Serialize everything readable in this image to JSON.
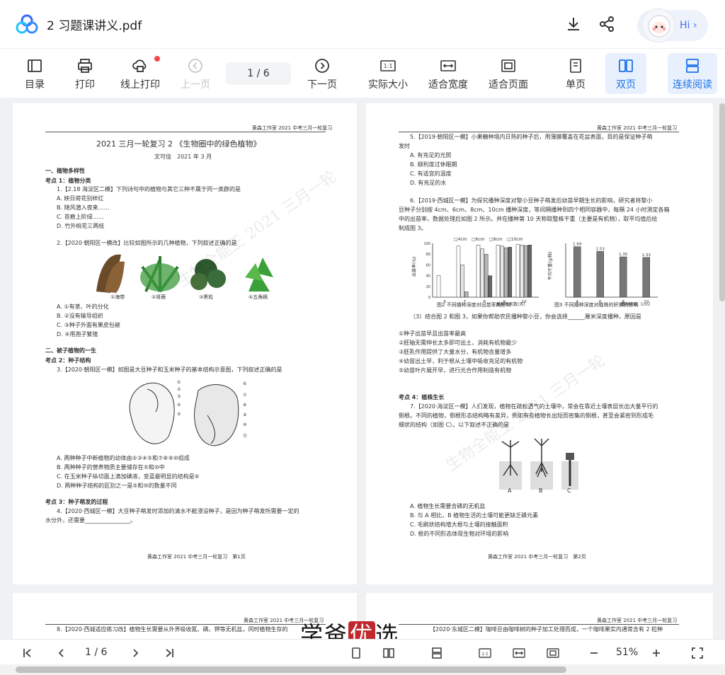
{
  "app": {
    "title": "2 习题课讲义.pdf",
    "assistant_label": "Hi"
  },
  "toolbar": {
    "items": [
      "目录",
      "打印",
      "线上打印",
      "上一页",
      "1 / 6",
      "下一页",
      "实际大小",
      "适合宽度",
      "适合页面",
      "单页",
      "双页",
      "连续阅读"
    ]
  },
  "bottom": {
    "page": "1 / 6",
    "zoom": "51%"
  },
  "colors": {
    "accent": "#1a73e8"
  },
  "page1": {
    "header": "黄森工作室 2021 中考三月一轮复习",
    "title": "2021 三月一轮复习 2 《生物圈中的绿色植物》",
    "author": "文可佳　2021 年 3 月",
    "lines": [
      "一、植物多样性",
      "考点 1：植物分类",
      "1.【2.18 海淀区二模】下列诗句中的植物与其它三种不属于同一类群的是",
      "A. 映日荷花别样红",
      "B. 随风潜入夜来……",
      "C. 苔痕上阶绿……",
      "D. 竹外桃花三两枝",
      "2.【2020·朝阳区一模改】比较如图所示的几种植物，下列叙述正确的是",
      "A. ①有茎、叶的分化",
      "B. ②没有输导组织",
      "C. ③种子外面有果皮包被",
      "D. ④用孢子繁殖",
      "二、被子植物的一生",
      "考点 2：种子结构",
      "3.【2020·朝阳区一模】如图是大豆种子和玉米种子的基本结构示意图，下列叙述正确的是",
      "A. 两种种子中新植物的幼体由②③④⑤和⑦⑧⑨⑩组成",
      "B. 两种种子的营养物质主要储存在⑤和⑩中",
      "C. 在玉米种子纵切面上滴加碘液，变蓝最明显的结构是⑥",
      "D. 两种种子结构的区别之一是⑤和⑩的数量不同",
      "考点 3：种子萌发的过程",
      "4.【2020·西城区一模】大豆种子萌发时添加的清水不能浸没种子，是因为种子萌发所需要一定的",
      "水分外，还需要________________。"
    ],
    "plant_labels": [
      "①海带",
      "②肾蕨",
      "③黑松",
      "④五角枫"
    ],
    "footer": "黄森工作室 2021 中考三月一轮复习　第1页",
    "watermark": "生物全能王 2021 三月一轮"
  },
  "page2": {
    "header": "黄森工作室 2021 中考三月一轮复习",
    "lines": [
      "5.【2019·朝阳区一模】小果糖种境内日熟的种子后，用薄膜覆盖在花盆表面，目的是保证种子萌",
      "发时",
      "A. 有充足的光照",
      "B. 顺利度过休眠期",
      "C. 有适宜的温度",
      "D. 有充足的水",
      "6.【2019·西城区一模】为探究播种深度对黎小豆种子萌发后幼苗早期生长的影响，研究者将黎小",
      "豆种子分别按 4cm、6cm、8cm、10cm 播种深度，等间隔播种到四个相同容器中，每隔 24 小时测定各箱",
      "中的出苗率，数据处理后如图 2 所示。并在播种第 10 天称取整株干重（主要是有机物），取平均值后绘",
      "制成图 3。",
      "（3）结合图 2 和图 3，如果你帮助农民播种黎小豆，你会选择______厘米深度播种，原因是",
      "①种子出苗早且出苗率最高",
      "②胚轴无需伸长太多即可出土，消耗有机物最少",
      "③胚乳作用提供了大量水分，有机物含量增多",
      "④幼苗出土早，利于根从土壤中吸收充足的有机物",
      "⑤幼苗叶片展开早，进行光合作用制造有机物",
      "考点 4：植株生长",
      "7.【2020·海淀区一模】人们发现，植物在疏松透气的土壤中，常会在靠近土壤表层长出大量平行的",
      "侧根。不同的植物，侧根形态结构略有差异，例如有些植物长出短而密集的侧根，甚至会紧密到形成毛",
      "细状的结构（如图 C）。以下叙述不正确的是",
      "A. 植物生长需要含磷的无机盐",
      "B. 与 A 相比，B 植物生活的土壤可能更缺乏磷元素",
      "C. 毛刷状结构增大根与土壤的接触面积",
      "D. 根的不同形态体现生物对环境的影响"
    ],
    "fig2_caption": "图2 不同播种深度对出苗率的影响",
    "fig3_caption": "图3 不同播种深度对植株的积累的影响",
    "fig2_legend": [
      "□4cm",
      "□6cm",
      "□8cm",
      "□10cm"
    ],
    "fig2_xlabel": "播种后天数(天)",
    "fig2_ylabel": "出苗率(%)",
    "fig3_xlabel": "播种深度（cm）",
    "fig3_ylabel": "平均干重(g/株)",
    "abc": [
      "A",
      "B",
      "C"
    ],
    "footer": "黄森工作室 2021 中考三月一轮复习　第2页",
    "watermark": "生物全能王 2021 三月一轮"
  },
  "page3": {
    "header": "黄森工作室 2021 中考三月一轮复习",
    "line": "8.【2020·西城适应练习改】植物生长需要从外界吸收氮、磷、钾等无机盐，同时植物生存的"
  },
  "page4": {
    "header": "黄森工作室 2021 中考三月一轮复习",
    "line": "【2020·东城区二模】咖啡豆由咖啡树的种子加工处理而成，一个咖啡果实内通常含有 2 粒种"
  },
  "brand": {
    "a": "学爸",
    "b": "优",
    "c": "选"
  },
  "chart_data": [
    {
      "type": "bar",
      "title": "图2 不同播种深度对出苗率的影响",
      "xlabel": "播种后天数(天)",
      "ylabel": "出苗率(%)",
      "categories": [
        "6",
        "7",
        "8",
        "9",
        "10"
      ],
      "ylim": [
        0,
        100
      ],
      "series": [
        {
          "name": "4cm",
          "values": [
            40,
            95,
            97,
            97,
            98
          ]
        },
        {
          "name": "6cm",
          "values": [
            0,
            60,
            90,
            95,
            97
          ]
        },
        {
          "name": "8cm",
          "values": [
            0,
            10,
            80,
            92,
            96
          ]
        },
        {
          "name": "10cm",
          "values": [
            0,
            0,
            40,
            93,
            97
          ]
        }
      ]
    },
    {
      "type": "bar",
      "title": "图3 不同播种深度对植株的积累的影响",
      "xlabel": "播种深度（cm）",
      "ylabel": "平均干重(g/株)",
      "categories": [
        "4",
        "6",
        "8",
        "10"
      ],
      "ylim": [
        0,
        1.8
      ],
      "values": [
        1.69,
        1.53,
        1.35,
        1.33
      ]
    }
  ]
}
